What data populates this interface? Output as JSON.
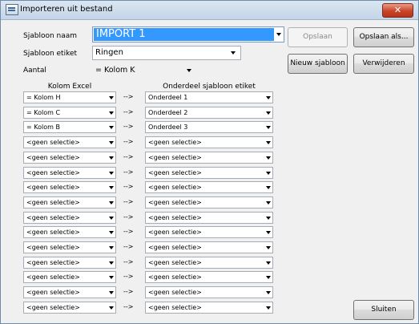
{
  "window": {
    "title": "Importeren uit bestand",
    "close_label": "✕"
  },
  "form": {
    "sjabloon_naam_label": "Sjabloon naam",
    "sjabloon_naam_value": "IMPORT 1",
    "sjabloon_etiket_label": "Sjabloon etiket",
    "sjabloon_etiket_value": "Ringen",
    "aantal_label": "Aantal",
    "aantal_value": "= Kolom K"
  },
  "buttons": {
    "opslaan": "Opslaan",
    "opslaan_als": "Opslaan als...",
    "nieuw_sjabloon": "Nieuw sjabloon",
    "verwijderen": "Verwijderen",
    "sluiten": "Sluiten"
  },
  "mapping": {
    "col_excel_header": "Kolom Excel",
    "col_onderdeel_header": "Onderdeel sjabloon etiket",
    "arrow": "-->",
    "rows": [
      {
        "excel": "= Kolom H",
        "onderdeel": "Onderdeel 1"
      },
      {
        "excel": "= Kolom C",
        "onderdeel": "Onderdeel 2"
      },
      {
        "excel": "= Kolom B",
        "onderdeel": "Onderdeel 3"
      },
      {
        "excel": "<geen selectie>",
        "onderdeel": "<geen selectie>"
      },
      {
        "excel": "<geen selectie>",
        "onderdeel": "<geen selectie>"
      },
      {
        "excel": "<geen selectie>",
        "onderdeel": "<geen selectie>"
      },
      {
        "excel": "<geen selectie>",
        "onderdeel": "<geen selectie>"
      },
      {
        "excel": "<geen selectie>",
        "onderdeel": "<geen selectie>"
      },
      {
        "excel": "<geen selectie>",
        "onderdeel": "<geen selectie>"
      },
      {
        "excel": "<geen selectie>",
        "onderdeel": "<geen selectie>"
      },
      {
        "excel": "<geen selectie>",
        "onderdeel": "<geen selectie>"
      },
      {
        "excel": "<geen selectie>",
        "onderdeel": "<geen selectie>"
      },
      {
        "excel": "<geen selectie>",
        "onderdeel": "<geen selectie>"
      },
      {
        "excel": "<geen selectie>",
        "onderdeel": "<geen selectie>"
      },
      {
        "excel": "<geen selectie>",
        "onderdeel": "<geen selectie>"
      }
    ]
  },
  "colors": {
    "selection_highlight": "#3399ff",
    "close_button": "#c8452a"
  }
}
